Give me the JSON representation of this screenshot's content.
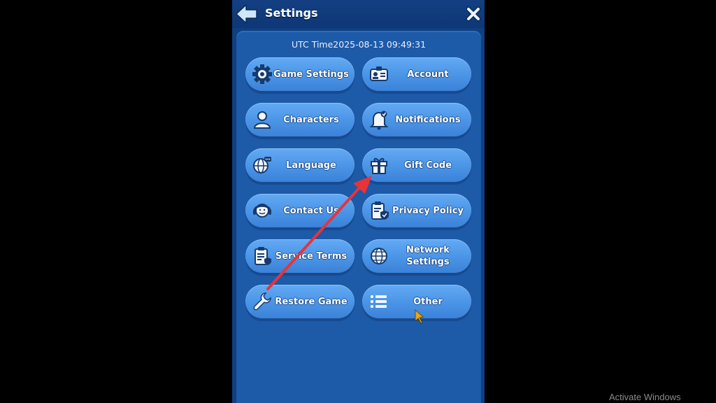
{
  "header": {
    "title": "Settings",
    "back_icon": "back-arrow-icon",
    "close_icon": "close-icon"
  },
  "utc_time": "UTC Time2025-08-13 09:49:31",
  "buttons": [
    {
      "label": "Game Settings",
      "icon": "gear-icon"
    },
    {
      "label": "Account",
      "icon": "id-card-icon"
    },
    {
      "label": "Characters",
      "icon": "person-icon"
    },
    {
      "label": "Notifications",
      "icon": "bell-icon"
    },
    {
      "label": "Language",
      "icon": "globe-chat-icon"
    },
    {
      "label": "Gift Code",
      "icon": "gift-icon"
    },
    {
      "label": "Contact Us",
      "icon": "headset-icon"
    },
    {
      "label": "Privacy Policy",
      "icon": "clipboard-shield-icon"
    },
    {
      "label": "Service Terms",
      "icon": "clipboard-icon"
    },
    {
      "label": "Network\nSettings",
      "icon": "globe-icon"
    },
    {
      "label": "Restore Game",
      "icon": "wrench-icon"
    },
    {
      "label": "Other",
      "icon": "list-icon"
    }
  ],
  "watermark": "Activate Windows",
  "colors": {
    "background": "#0f3f80",
    "panel": "#1d5aa8",
    "button": "#4a94e6",
    "annotation_arrow": "#e8333a"
  }
}
